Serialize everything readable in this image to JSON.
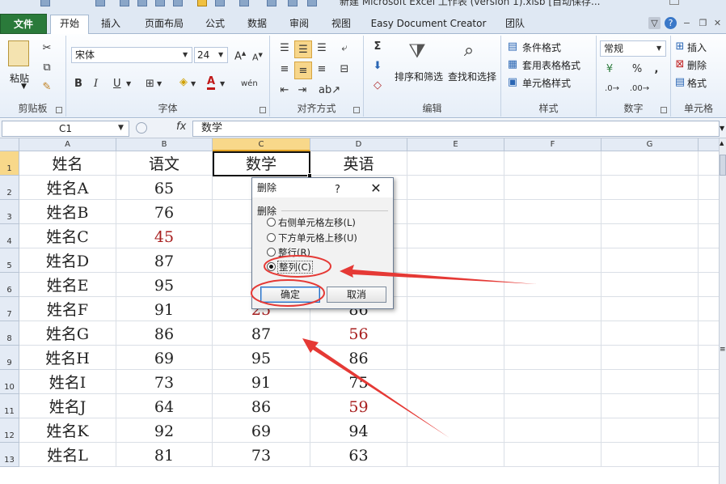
{
  "titlebar": {
    "title": "新建 Microsoft Excel 工作表 (version 1).xlsb [自动保存..."
  },
  "tabs": [
    "文件",
    "开始",
    "插入",
    "页面布局",
    "公式",
    "数据",
    "审阅",
    "视图",
    "Easy Document Creator",
    "团队"
  ],
  "ribbon": {
    "clipboard": {
      "label": "剪贴板",
      "paste": "粘贴"
    },
    "font": {
      "label": "字体",
      "font_name": "宋体",
      "font_size": "24"
    },
    "alignment": {
      "label": "对齐方式"
    },
    "edit": {
      "label": "编辑",
      "sort": "排序和筛选",
      "find": "查找和选择"
    },
    "styles": {
      "label": "样式",
      "cond": "条件格式",
      "table": "套用表格格式",
      "cellstyle": "单元格样式"
    },
    "number": {
      "label": "数字",
      "format": "常规"
    },
    "cells": {
      "label": "单元格",
      "insert": "插入",
      "delete": "删除",
      "format": "格式"
    }
  },
  "formula_bar": {
    "name_box": "C1",
    "fx": "fx",
    "content": "数学"
  },
  "sheet": {
    "columns": [
      "A",
      "B",
      "C",
      "D",
      "E",
      "F",
      "G"
    ],
    "rows": [
      "1",
      "2",
      "3",
      "4",
      "5",
      "6",
      "7",
      "8",
      "9",
      "10",
      "11",
      "12",
      "13"
    ],
    "header": [
      "姓名",
      "语文",
      "数学",
      "英语"
    ],
    "data": [
      [
        "姓名A",
        "65",
        "",
        ""
      ],
      [
        "姓名B",
        "76",
        "",
        ""
      ],
      [
        "姓名C",
        "45",
        "",
        ""
      ],
      [
        "姓名D",
        "87",
        "",
        ""
      ],
      [
        "姓名E",
        "95",
        "",
        ""
      ],
      [
        "姓名F",
        "91",
        "25",
        "86"
      ],
      [
        "姓名G",
        "86",
        "87",
        "56"
      ],
      [
        "姓名H",
        "69",
        "95",
        "86"
      ],
      [
        "姓名I",
        "73",
        "91",
        "75"
      ],
      [
        "姓名J",
        "64",
        "86",
        "59"
      ],
      [
        "姓名K",
        "92",
        "69",
        "94"
      ],
      [
        "姓名L",
        "81",
        "73",
        "63"
      ]
    ],
    "red_color": "#a82020"
  },
  "dialog": {
    "title": "删除",
    "help": "?",
    "close": "✕",
    "group": "删除",
    "options": [
      "右侧单元格左移(L)",
      "下方单元格上移(U)",
      "整行(R)",
      "整列(C)"
    ],
    "selected_index": 3,
    "ok": "确定",
    "cancel": "取消"
  },
  "annotation_color": "#e53935"
}
